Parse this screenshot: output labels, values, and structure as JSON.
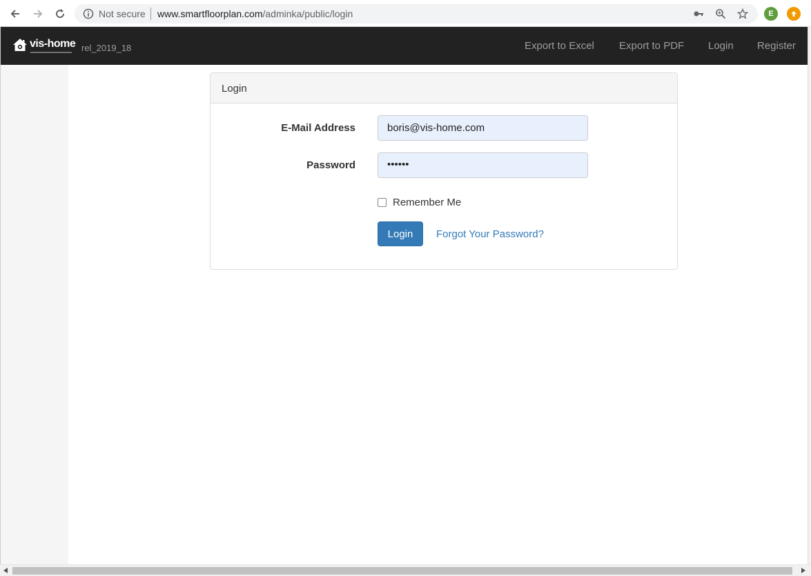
{
  "browser": {
    "security_label": "Not secure",
    "url_domain": "www.smartfloorplan.com",
    "url_path": "/adminka/public/login",
    "profile_initial": "E",
    "profile_color": "#5f9e3d",
    "extension_color": "#f29900"
  },
  "navbar": {
    "brand": "vis-home",
    "release": "rel_2019_18",
    "links": [
      "Export to Excel",
      "Export to PDF",
      "Login",
      "Register"
    ],
    "background": "#222222"
  },
  "panel": {
    "heading": "Login",
    "email_label": "E-Mail Address",
    "email_value": "boris@vis-home.com",
    "password_label": "Password",
    "password_value": "••••••",
    "remember_label": "Remember Me",
    "remember_checked": false,
    "login_button": "Login",
    "forgot_link": "Forgot Your Password?",
    "accent": "#337ab7"
  }
}
